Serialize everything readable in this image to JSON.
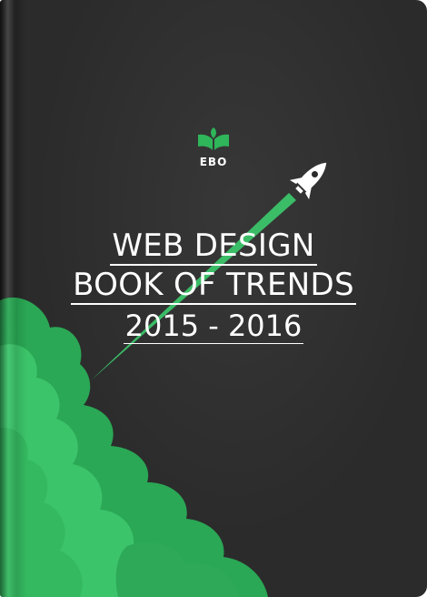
{
  "book": {
    "brand": "EBO",
    "title_line1": "WEB DESIGN",
    "title_line2": "BOOK OF TRENDS",
    "title_line3": "2015 - 2016"
  },
  "colors": {
    "cover_bg": "#2b2b2b",
    "accent_green": "#2fb55a",
    "smoke_light": "#3cc46a",
    "text": "#ffffff"
  },
  "icons": {
    "logo": "open-book-leaf-icon",
    "rocket": "rocket-icon"
  }
}
